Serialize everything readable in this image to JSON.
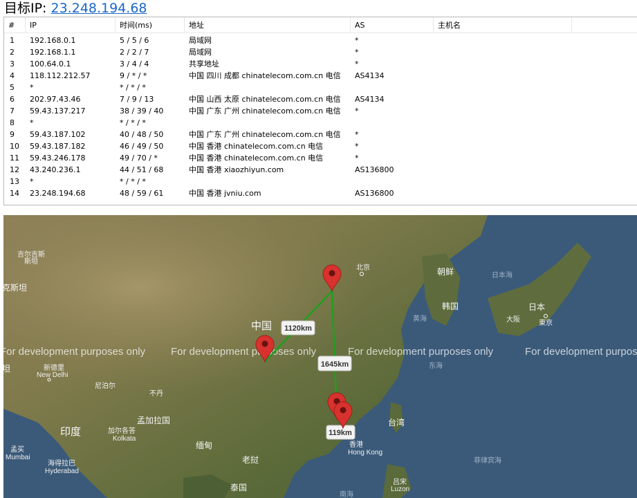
{
  "header": {
    "label": "目标IP: ",
    "target_ip": "23.248.194.68"
  },
  "table": {
    "columns": [
      "#",
      "IP",
      "时间(ms)",
      "地址",
      "AS",
      "主机名"
    ],
    "rows": [
      {
        "n": "1",
        "ip": "192.168.0.1",
        "time": "5 / 5 / 6",
        "addr": "局域网",
        "as": "*",
        "host": ""
      },
      {
        "n": "2",
        "ip": "192.168.1.1",
        "time": "2 / 2 / 7",
        "addr": "局域网",
        "as": "*",
        "host": ""
      },
      {
        "n": "3",
        "ip": "100.64.0.1",
        "time": "3 / 4 / 4",
        "addr": "共享地址",
        "as": "*",
        "host": ""
      },
      {
        "n": "4",
        "ip": "118.112.212.57",
        "time": "9 / * / *",
        "addr": "中国 四川 成都 chinatelecom.com.cn 电信",
        "as": "AS4134",
        "host": ""
      },
      {
        "n": "5",
        "ip": "*",
        "time": "* / * / *",
        "addr": "",
        "as": "",
        "host": ""
      },
      {
        "n": "6",
        "ip": "202.97.43.46",
        "time": "7 / 9 / 13",
        "addr": "中国 山西 太原 chinatelecom.com.cn 电信",
        "as": "AS4134",
        "host": ""
      },
      {
        "n": "7",
        "ip": "59.43.137.217",
        "time": "38 / 39 / 40",
        "addr": "中国 广东 广州 chinatelecom.com.cn 电信",
        "as": "*",
        "host": ""
      },
      {
        "n": "8",
        "ip": "*",
        "time": "* / * / *",
        "addr": "",
        "as": "",
        "host": ""
      },
      {
        "n": "9",
        "ip": "59.43.187.102",
        "time": "40 / 48 / 50",
        "addr": "中国 广东 广州 chinatelecom.com.cn 电信",
        "as": "*",
        "host": ""
      },
      {
        "n": "10",
        "ip": "59.43.187.182",
        "time": "46 / 49 / 50",
        "addr": "中国 香港 chinatelecom.com.cn 电信",
        "as": "*",
        "host": ""
      },
      {
        "n": "11",
        "ip": "59.43.246.178",
        "time": "49 / 70 / *",
        "addr": "中国 香港 chinatelecom.com.cn 电信",
        "as": "*",
        "host": ""
      },
      {
        "n": "12",
        "ip": "43.240.236.1",
        "time": "44 / 51 / 68",
        "addr": "中国 香港 xiaozhiyun.com",
        "as": "AS136800",
        "host": ""
      },
      {
        "n": "13",
        "ip": "*",
        "time": "* / * / *",
        "addr": "",
        "as": "",
        "host": ""
      },
      {
        "n": "14",
        "ip": "23.248.194.68",
        "time": "48 / 59 / 61",
        "addr": "中国 香港 jvniu.com",
        "as": "AS136800",
        "host": ""
      }
    ]
  },
  "map": {
    "watermark": "For development purposes only",
    "distances": [
      "1120km",
      "1645km",
      "119km"
    ],
    "labels": {
      "china": "中国",
      "beijing": "北京",
      "chaoxian": "朝鲜",
      "hanguo": "韩国",
      "riben": "日本",
      "dongjing_cn": "東京",
      "dongjing_en": "Tokyo",
      "daban": "大阪",
      "ribenhai": "日本海",
      "huanghai": "黄海",
      "donghai": "东海",
      "taiwan": "台湾",
      "xianggang_cn": "香港",
      "xianggang_en": "Hong Kong",
      "feilvbinhai": "菲律宾海",
      "lvsong_cn": "吕宋",
      "lvsong_en": "Luzon",
      "nanhai": "南海",
      "yindu": "印度",
      "mengjiala": "孟加拉国",
      "jiaergeda_cn": "加尔各答",
      "jiaergeda_en": "Kolkata",
      "mengmai_cn": "孟买",
      "mengmai_en": "Mumbai",
      "haidela_cn": "海得拉巴",
      "haidela_en": "Hyderabad",
      "xindeli_cn": "新德里",
      "xindeli_en": "New Delhi",
      "niboer": "尼泊尔",
      "buDan": "不丹",
      "miandian": "缅甸",
      "laowo": "老挝",
      "taiguo": "泰国",
      "jierjisi_cn": "吉尔吉斯",
      "jierjisi_cn2": "斯坦",
      "kesitan": "克斯坦",
      "dan": "坦"
    },
    "colors": {
      "route": "#1ea01e",
      "pin": "#d8322e",
      "ocean": "#3b5a79"
    }
  }
}
